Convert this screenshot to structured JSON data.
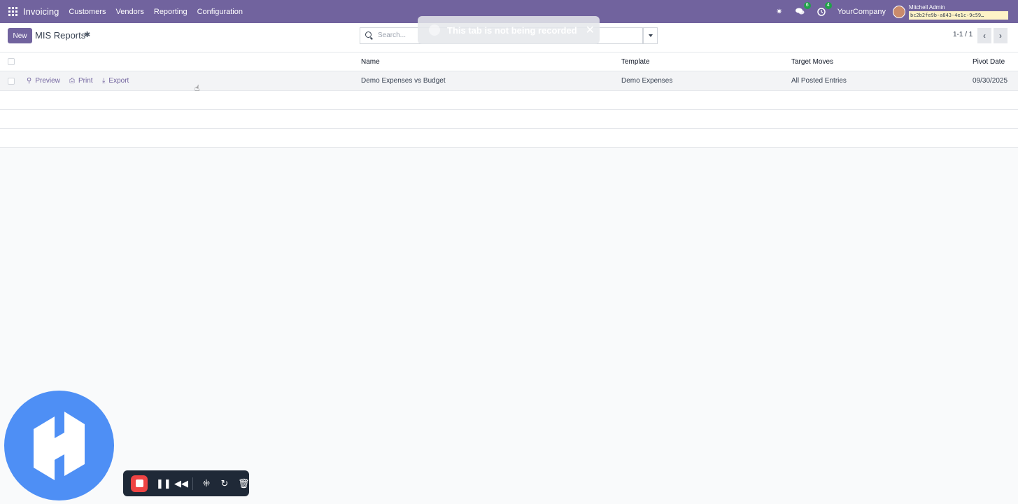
{
  "navbar": {
    "app_name": "Invoicing",
    "menu": [
      "Customers",
      "Vendors",
      "Reporting",
      "Configuration"
    ],
    "chat_badge": "6",
    "activity_badge": "4",
    "company": "YourCompany",
    "user": "Mitchell Admin",
    "db_tag": "bc2b2fe9b-a843-4e1c-9c59…"
  },
  "control": {
    "new_label": "New",
    "title": "MIS Reports",
    "search_placeholder": "Search...",
    "pager": "1-1 / 1"
  },
  "toast": {
    "text": "This tab is not being recorded"
  },
  "list": {
    "columns": [
      "Name",
      "Template",
      "Target Moves",
      "Pivot Date"
    ],
    "rows": [
      {
        "actions": [
          "Preview",
          "Print",
          "Export"
        ],
        "name": "Demo Expenses vs Budget",
        "template": "Demo Expenses",
        "target_moves": "All Posted Entries",
        "pivot_date": "09/30/2025"
      }
    ]
  },
  "colors": {
    "brand": "#71639e",
    "recorder_accent": "#ef4444",
    "recorder_logo": "#4e8ff5"
  }
}
